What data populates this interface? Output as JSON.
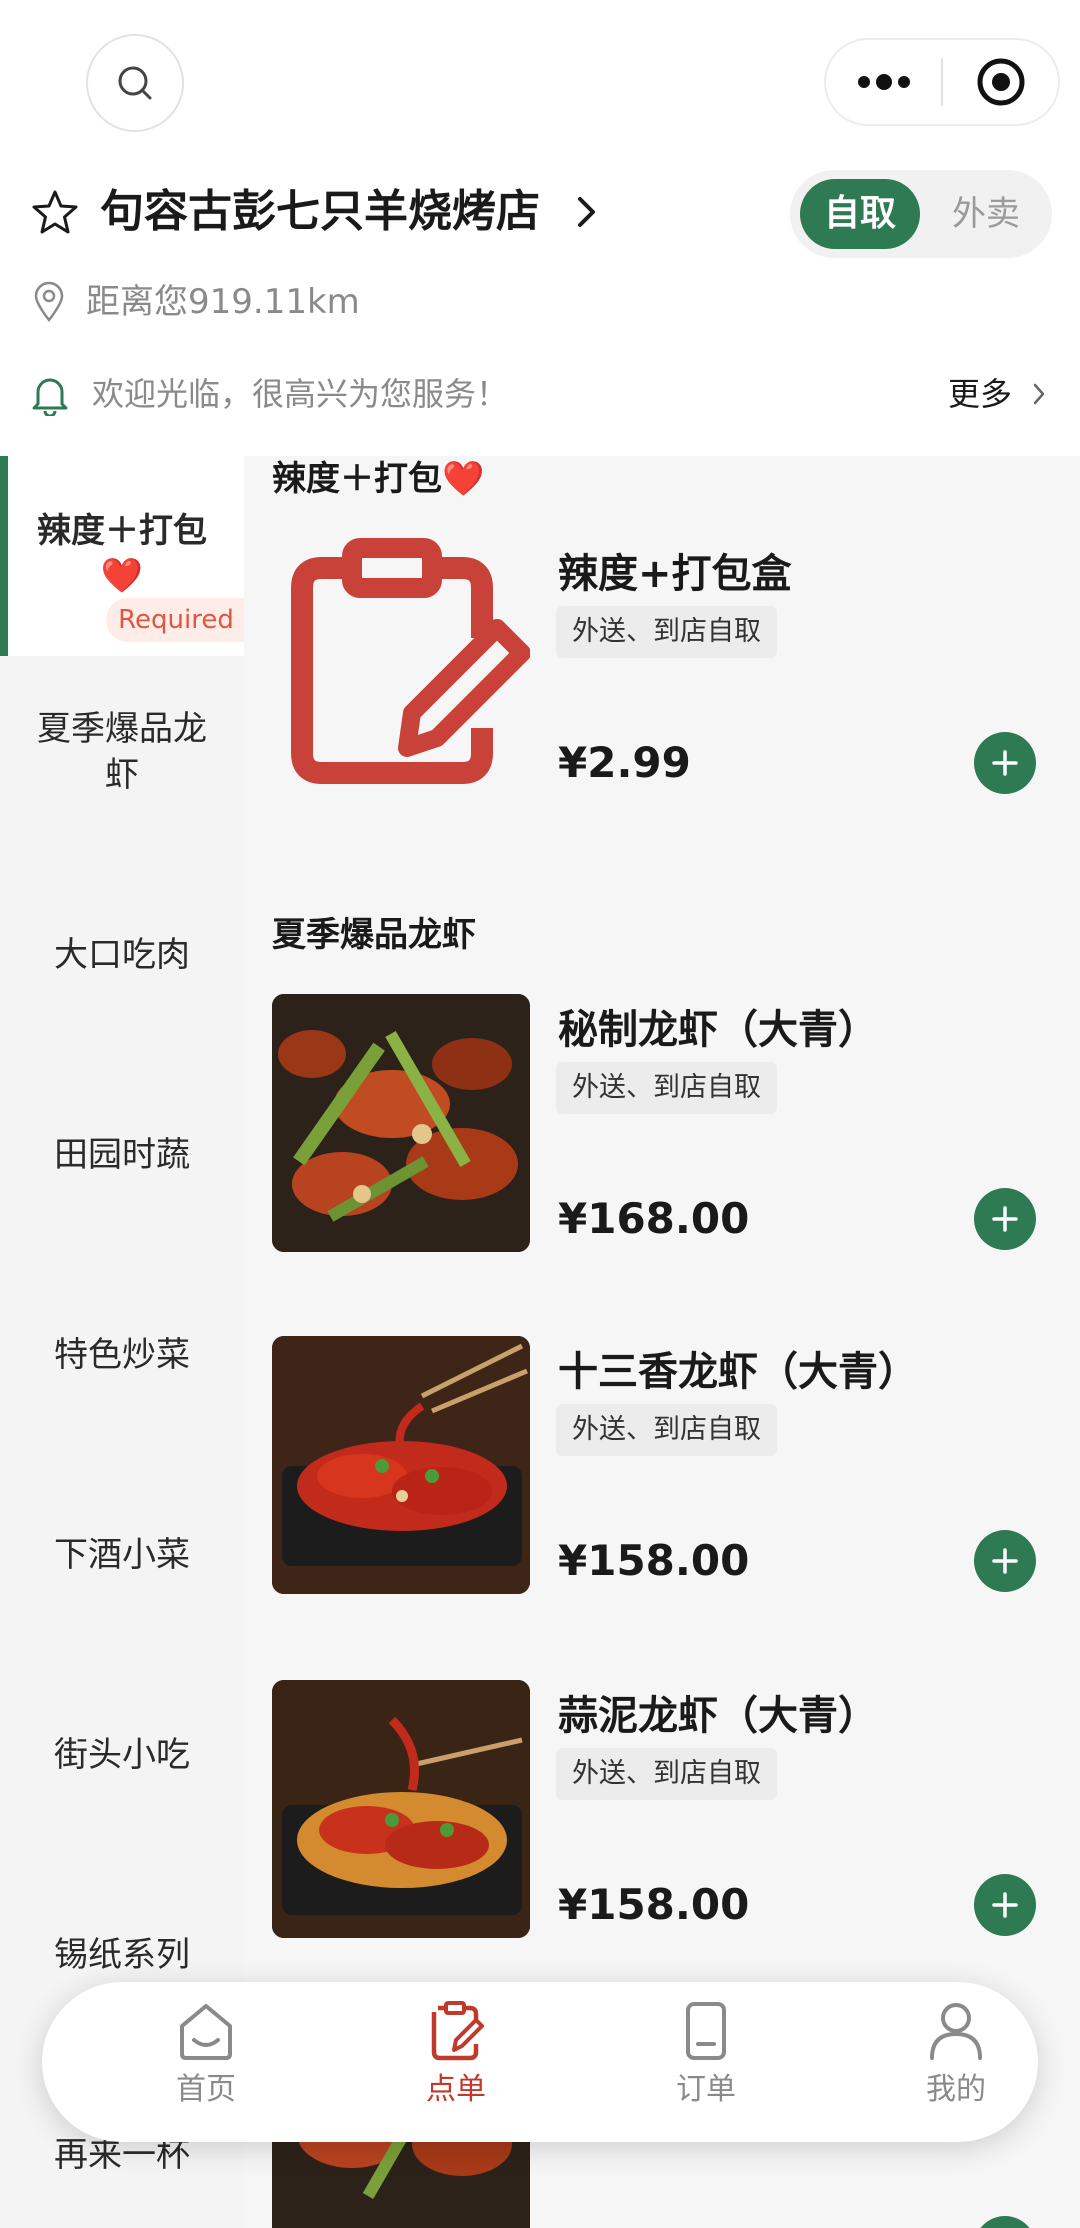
{
  "header": {
    "shop_name": "句容古彭七只羊烧烤店",
    "mode_pickup": "自取",
    "mode_delivery": "外卖",
    "distance": "距离您919.11km",
    "notice": "欢迎光临，很高兴为您服务！",
    "more": "更多"
  },
  "colors": {
    "accent": "#2e7a52",
    "active_tab": "#c0392b",
    "required": "#e0573f"
  },
  "sidebar": {
    "items": [
      {
        "label": "辣度＋打包",
        "emoji": "❤️",
        "badge": "Required",
        "active": true
      },
      {
        "label": "夏季爆品龙",
        "label2": "虾"
      },
      {
        "label": "大口吃肉"
      },
      {
        "label": "田园时蔬"
      },
      {
        "label": "特色炒菜"
      },
      {
        "label": "下酒小菜"
      },
      {
        "label": "街头小吃"
      },
      {
        "label": "锡纸系列"
      },
      {
        "label": "再来一杯"
      }
    ]
  },
  "sections": [
    {
      "title": "辣度＋打包❤️",
      "items": [
        {
          "name": "辣度+打包盒",
          "tag": "外送、到店自取",
          "price": "¥2.99",
          "image": "clipboard-pencil-icon"
        }
      ]
    },
    {
      "title": "夏季爆品龙虾",
      "items": [
        {
          "name": "秘制龙虾（大青）",
          "tag": "外送、到店自取",
          "price": "¥168.00",
          "image": "crayfish-photo"
        },
        {
          "name": "十三香龙虾（大青）",
          "tag": "外送、到店自取",
          "price": "¥158.00",
          "image": "crayfish-photo"
        },
        {
          "name": "蒜泥龙虾（大青）",
          "tag": "外送、到店自取",
          "price": "¥158.00",
          "image": "crayfish-photo"
        }
      ]
    }
  ],
  "tabbar": {
    "tabs": [
      {
        "label": "首页",
        "icon": "home-icon"
      },
      {
        "label": "点单",
        "icon": "order-icon",
        "active": true
      },
      {
        "label": "订单",
        "icon": "receipt-icon"
      },
      {
        "label": "我的",
        "icon": "user-icon"
      }
    ]
  }
}
